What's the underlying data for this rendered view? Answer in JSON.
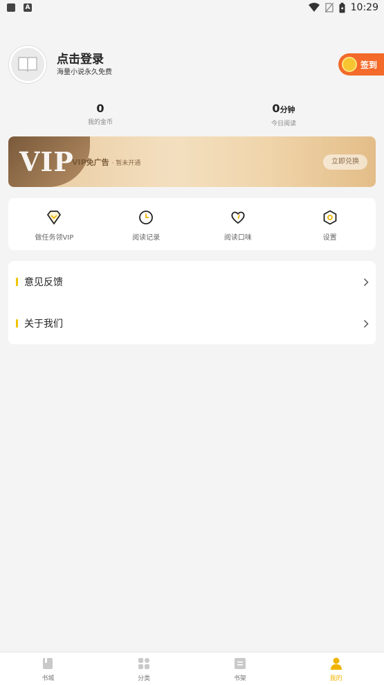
{
  "status_bar": {
    "time": "10:29"
  },
  "profile": {
    "login_title": "点击登录",
    "subtitle": "海量小说永久免费",
    "signin_label": "签到"
  },
  "stats": {
    "coins_value": "0",
    "coins_label": "我的金币",
    "reading_value": "0",
    "reading_unit": "分钟",
    "reading_label": "今日阅读"
  },
  "vip_banner": {
    "logo_text": "VIP",
    "title": "VIP免广告",
    "status": "· 暂未开通",
    "redeem_label": "立即兑换"
  },
  "quick_actions": [
    {
      "label": "做任务领VIP",
      "icon": "diamond-icon"
    },
    {
      "label": "阅读记录",
      "icon": "clock-icon"
    },
    {
      "label": "阅读口味",
      "icon": "heart-icon"
    },
    {
      "label": "设置",
      "icon": "gear-icon"
    }
  ],
  "menu": [
    {
      "label": "意见反馈"
    },
    {
      "label": "关于我们"
    }
  ],
  "bottom_nav": [
    {
      "label": "书城",
      "icon": "book-icon",
      "active": false
    },
    {
      "label": "分类",
      "icon": "grid-icon",
      "active": false
    },
    {
      "label": "书架",
      "icon": "shelf-icon",
      "active": false
    },
    {
      "label": "我的",
      "icon": "person-icon",
      "active": true
    }
  ],
  "colors": {
    "accent": "#f0b400",
    "signin_bg": "#f36a2a",
    "vip_gold": "#e8c99d",
    "menu_bar": "#f0c400"
  }
}
